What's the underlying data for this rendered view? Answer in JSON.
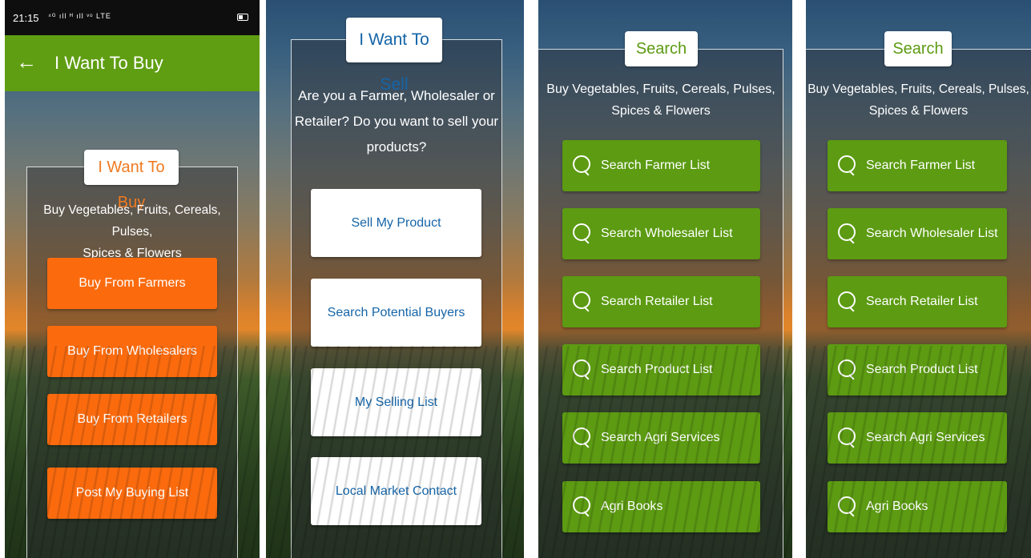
{
  "screen1": {
    "status": {
      "time": "21:15",
      "signal": "⁴ᴳ ıll ᴴ ıll ᵛᵒ LTE"
    },
    "appbar": {
      "back_glyph": "←",
      "title": "I Want To Buy"
    },
    "header": "I Want To Buy",
    "subtitle_line1": "Buy Vegetables, Fruits, Cereals, Pulses,",
    "subtitle_line2": "Spices & Flowers",
    "buttons": [
      "Buy From Farmers",
      "Buy From Wholesalers",
      "Buy From Retailers",
      "Post My Buying List"
    ],
    "colors": {
      "accent": "#fb6b0e",
      "appbar": "#5f9e12",
      "header_text": "#f07a20"
    }
  },
  "screen2": {
    "header": "I Want To Sell",
    "question_line1": "Are you a Farmer, Wholesaler or",
    "question_line2": "Retailer? Do you want to sell your",
    "question_line3": "products?",
    "buttons": [
      "Sell My Product",
      "Search Potential Buyers",
      "My Selling List",
      "Local Market Contact"
    ],
    "colors": {
      "button_text": "#1565a8",
      "header_text": "#1565a8"
    }
  },
  "screen3": {
    "header": "Search",
    "subtitle_line1": "Buy Vegetables, Fruits, Cereals, Pulses,",
    "subtitle_line2": "Spices & Flowers",
    "buttons": [
      "Search Farmer List",
      "Search Wholesaler List",
      "Search Retailer List",
      "Search Product List",
      "Search Agri Services",
      "Agri Books"
    ],
    "colors": {
      "button": "#5c9b12",
      "header_text": "#5c9b12"
    }
  },
  "screen4": {
    "header": "Search",
    "subtitle_line1": "Buy Vegetables, Fruits, Cereals, Pulses,",
    "subtitle_line2": "Spices & Flowers",
    "buttons": [
      "Search Farmer List",
      "Search Wholesaler List",
      "Search Retailer List",
      "Search Product List",
      "Search Agri Services",
      "Agri Books"
    ],
    "colors": {
      "button": "#5c9b12",
      "header_text": "#5c9b12"
    }
  }
}
